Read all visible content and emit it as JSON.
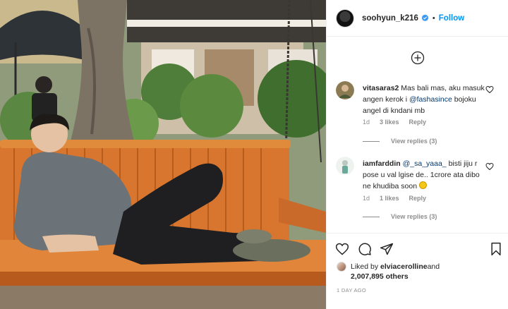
{
  "post": {
    "username": "soohyun_k216",
    "separator": "•",
    "follow_label": "Follow"
  },
  "comments": [
    {
      "username": "vitasaras2",
      "text_before": " Mas bali mas, aku masuk angen kerok i ",
      "mention": "@fashasince",
      "text_after": " bojoku angel di kndani mb",
      "time": "1d",
      "likes": "3 likes",
      "reply_label": "Reply",
      "view_replies": "View replies (3)"
    },
    {
      "username": "iamfarddin",
      "text_before": " ",
      "mention": "@_sa_yaaa_",
      "text_after": " bisti jiju r pose u val lgise de.. 1crore ata dibo ne khudiba soon",
      "emoji": "grinning-face-emoji",
      "time": "1d",
      "likes": "1 likes",
      "reply_label": "Reply",
      "view_replies": "View replies (3)"
    }
  ],
  "footer": {
    "liked_prefix": "Liked by ",
    "liked_user": "elviacerolline",
    "liked_and": " and",
    "likes_count": "2,007,895 others",
    "time_ago": "1 DAY AGO"
  },
  "icons": {
    "verified": "verified-badge-icon",
    "load_more": "plus-circle-icon",
    "like": "heart-icon",
    "comment": "comment-bubble-icon",
    "share": "paper-plane-icon",
    "save": "bookmark-icon"
  },
  "colors": {
    "link_blue": "#0095f6",
    "mention": "#00376b",
    "muted": "#8e8e8e",
    "text": "#262626"
  }
}
